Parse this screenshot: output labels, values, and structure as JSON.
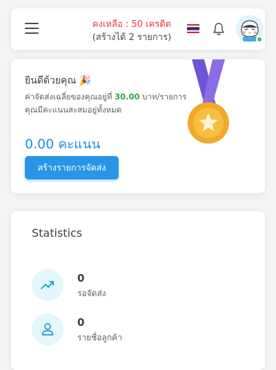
{
  "header": {
    "credit_line1": "คงเหลือ : 50 เครดิต",
    "credit_line2": "(สร้างได้ 2 รายการ)",
    "icons": [
      "menu-icon",
      "thai-flag-icon",
      "bell-icon",
      "avatar"
    ],
    "credit_color": "#ea3a3a",
    "avatar_badge": "Ninja"
  },
  "welcome": {
    "title": "ยินดีด้วยคุณ 🎉",
    "line1_prefix": "ค่าจัดส่งเฉลี่ยของคุณอยู่ที่",
    "line1_value": "30.00",
    "line1_suffix": "บาท/รายการ",
    "line2": "คุณมีคะแนนสะสมอยู่ทั้งหมด",
    "points": "0.00 คะแนน",
    "button_label": "สร้างรายการจัดส่ง",
    "accent_color": "#2a95e6",
    "icon": "medal-icon"
  },
  "stats": {
    "title": "Statistics",
    "items": [
      {
        "value": "0",
        "label": "รอจัดส่ง",
        "icon": "trending-up-icon"
      },
      {
        "value": "0",
        "label": "รายชื่อลูกค้า",
        "icon": "user-icon"
      }
    ]
  }
}
